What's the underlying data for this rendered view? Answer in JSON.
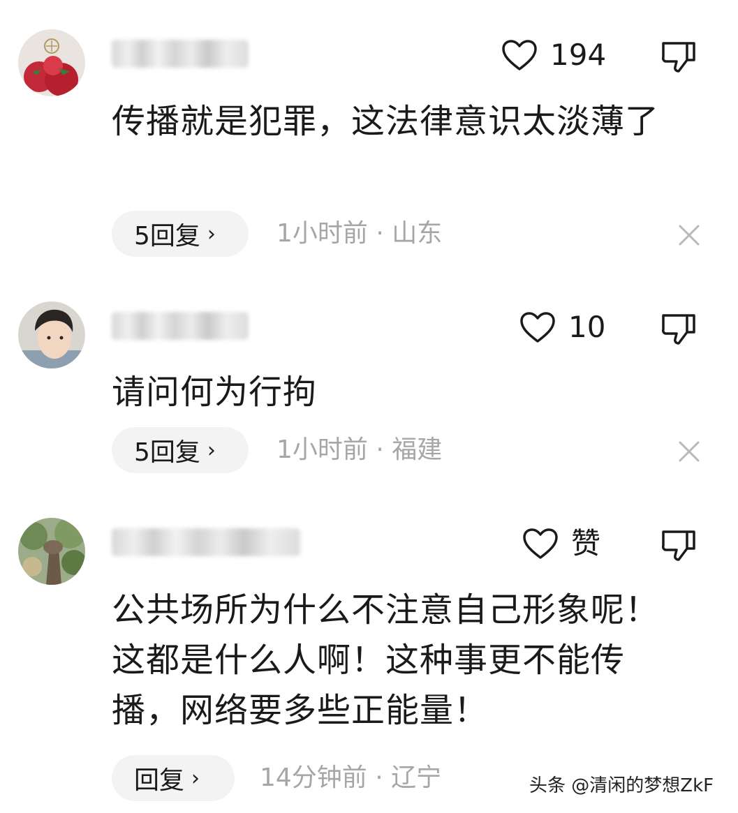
{
  "comments": [
    {
      "likes": "194",
      "text": "传播就是犯罪，这法律意识太淡薄了",
      "reply_label": "5回复",
      "reply_chevron": "›",
      "meta": "1小时前 · 山东",
      "avatar": "strawberry-cake-avatar"
    },
    {
      "likes": "10",
      "text": "请问何为行拘",
      "reply_label": "5回复",
      "reply_chevron": "›",
      "meta": "1小时前 · 福建",
      "avatar": "young-man-avatar"
    },
    {
      "likes": "赞",
      "text": "公共场所为什么不注意自己形象呢！这都是什么人啊！这种事更不能传播，网络要多些正能量！",
      "reply_label": "回复",
      "reply_chevron": "›",
      "meta": "14分钟前 · 辽宁",
      "avatar": "tree-garden-avatar"
    }
  ],
  "watermark": "头条 @清闲的梦想ZkF",
  "colors": {
    "text": "#1a1a1a",
    "meta": "#a6a6a6",
    "pill": "#f3f3f3",
    "icon": "#1a1a1a"
  },
  "icons": {
    "like": "heart-outline-icon",
    "dislike": "thumbs-down-icon",
    "dismiss": "close-icon"
  }
}
